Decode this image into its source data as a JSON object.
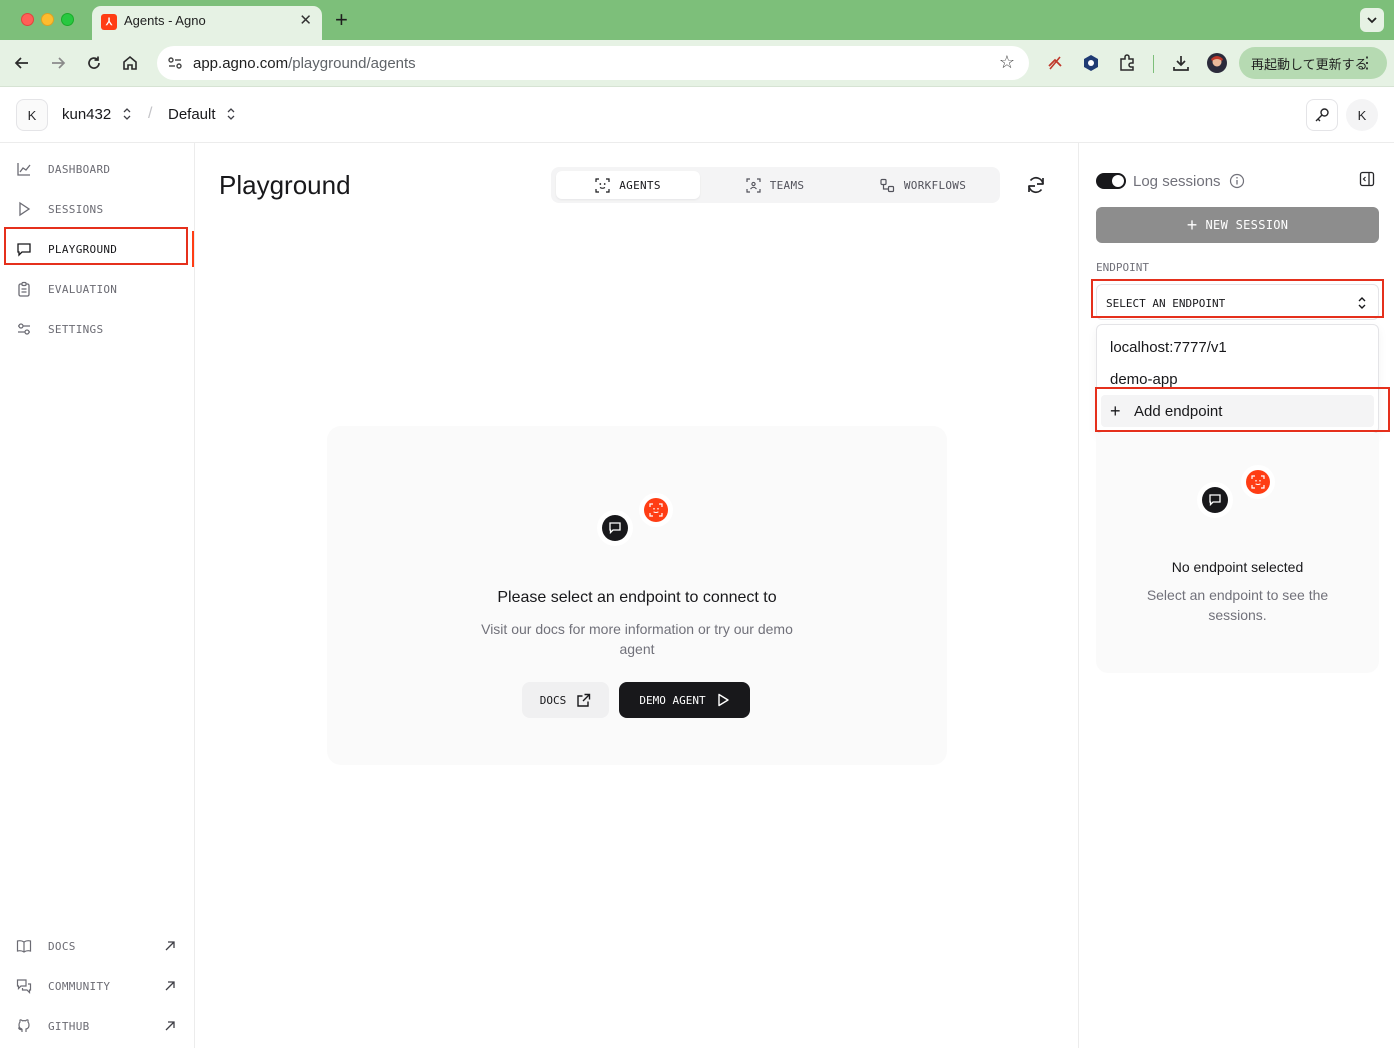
{
  "browser": {
    "tab_title": "Agents - Agno",
    "url_host": "app.agno.com",
    "url_path": "/playground/agents",
    "update_button": "再起動して更新する"
  },
  "header": {
    "avatar_initial": "K",
    "org": "kun432",
    "separator": "/",
    "project": "Default",
    "user_initial": "K"
  },
  "sidebar": {
    "items": [
      {
        "label": "DASHBOARD",
        "icon": "chart-line-icon"
      },
      {
        "label": "SESSIONS",
        "icon": "play-icon"
      },
      {
        "label": "PLAYGROUND",
        "icon": "message-square-icon",
        "active": true
      },
      {
        "label": "EVALUATION",
        "icon": "clipboard-icon"
      },
      {
        "label": "SETTINGS",
        "icon": "sliders-icon"
      }
    ],
    "footer": [
      {
        "label": "DOCS",
        "icon": "book-icon"
      },
      {
        "label": "COMMUNITY",
        "icon": "chat-bubbles-icon"
      },
      {
        "label": "GITHUB",
        "icon": "github-icon"
      }
    ]
  },
  "main": {
    "title": "Playground",
    "tabs": [
      {
        "label": "AGENTS",
        "active": true
      },
      {
        "label": "TEAMS"
      },
      {
        "label": "WORKFLOWS"
      }
    ],
    "empty": {
      "title": "Please select an endpoint to connect to",
      "subtitle": "Visit our docs for more information or try our demo agent",
      "docs_button": "DOCS",
      "demo_button": "DEMO AGENT"
    }
  },
  "right_panel": {
    "log_sessions_label": "Log sessions",
    "log_sessions_on": true,
    "new_session_button": "NEW SESSION",
    "endpoint_label": "ENDPOINT",
    "select_placeholder": "SELECT AN ENDPOINT",
    "options": [
      "localhost:7777/v1",
      "demo-app"
    ],
    "add_endpoint": "Add endpoint",
    "empty_title": "No endpoint selected",
    "empty_subtitle": "Select an endpoint to see the sessions."
  },
  "colors": {
    "brand": "#ff3d14",
    "highlight": "#e5301c",
    "chrome_green": "#7dbf7a"
  }
}
